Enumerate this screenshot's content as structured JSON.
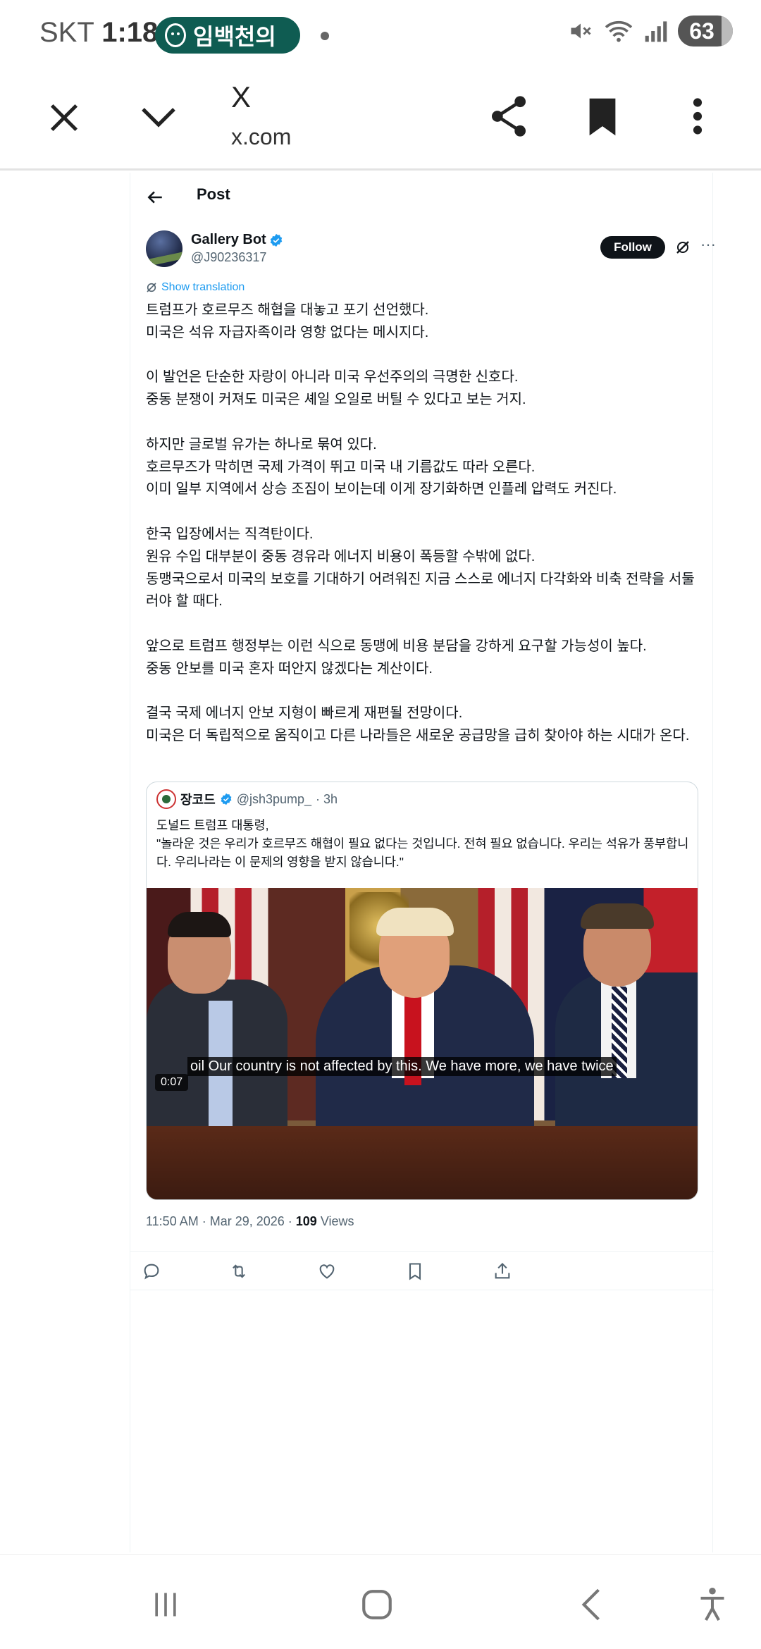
{
  "status_bar": {
    "carrier": "SKT",
    "time": "1:18",
    "notification": "임백천의",
    "battery": "63"
  },
  "browser": {
    "title": "X",
    "url": "x.com"
  },
  "post_header": {
    "title": "Post"
  },
  "author": {
    "name": "Gallery Bot",
    "handle": "@J90236317",
    "follow_label": "Follow"
  },
  "post": {
    "translate_label": "Show translation",
    "text": "트럼프가 호르무즈 해협을 대놓고 포기 선언했다.\n미국은 석유 자급자족이라 영향 없다는 메시지다.\n\n이 발언은 단순한 자랑이 아니라 미국 우선주의의 극명한 신호다.\n중동 분쟁이 커져도 미국은 셰일 오일로 버틸 수 있다고 보는 거지.\n\n하지만 글로벌 유가는 하나로 묶여 있다.\n호르무즈가 막히면 국제 가격이 뛰고 미국 내 기름값도 따라 오른다.\n이미 일부 지역에서 상승 조짐이 보이는데 이게 장기화하면 인플레 압력도 커진다.\n\n한국 입장에서는 직격탄이다.\n원유 수입 대부분이 중동 경유라 에너지 비용이 폭등할 수밖에 없다.\n동맹국으로서 미국의 보호를 기대하기 어려워진 지금 스스로 에너지 다각화와 비축 전략을 서둘러야 할 때다.\n\n앞으로 트럼프 행정부는 이런 식으로 동맹에 비용 분담을 강하게 요구할 가능성이 높다.\n중동 안보를 미국 혼자 떠안지 않겠다는 계산이다.\n\n결국 국제 에너지 안보 지형이 빠르게 재편될 전망이다.\n미국은 더 독립적으로 움직이고 다른 나라들은 새로운 공급망을 급히 찾아야 하는 시대가 온다.",
    "timestamp": "11:50 AM · Mar 29, 2026 · ",
    "views_count": "109",
    "views_label": " Views"
  },
  "quote": {
    "name": "장코드",
    "handle": "@jsh3pump_",
    "time": "· 3h",
    "text": "도널드 트럼프 대통령,\n\"놀라운 것은 우리가 호르무즈 해협이 필요 없다는 것입니다. 전혀 필요 없습니다. 우리는 석유가 풍부합니다. 우리나라는 이 문제의 영향을 받지 않습니다.\"",
    "video_caption": "oil Our country is not affected by this. We have more, we have twice",
    "video_duration": "0:07"
  },
  "icons": {
    "close": "close-icon",
    "chevron": "chevron-down-icon",
    "share": "share-icon",
    "bookmark": "bookmark-icon",
    "more": "more-vertical-icon",
    "verified_color": "#1d9bf0"
  }
}
